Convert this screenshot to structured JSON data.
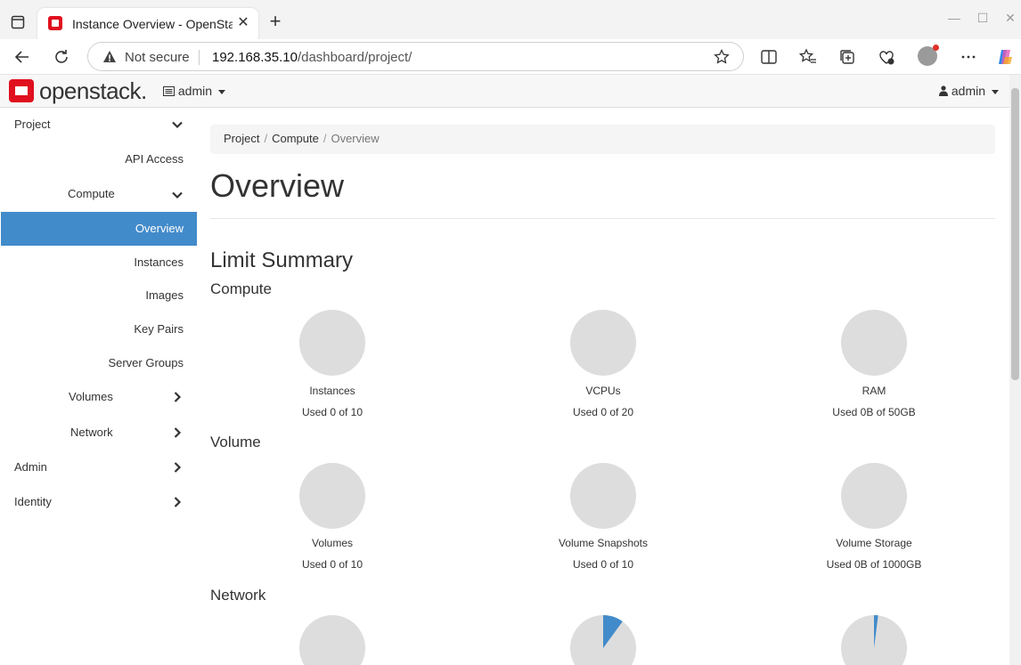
{
  "browser": {
    "tab_title": "Instance Overview - OpenStack",
    "tab_close": "✕",
    "new_tab": "+",
    "security": "Not secure",
    "url_host": "192.168.35.10",
    "url_path": "/dashboard/project/"
  },
  "header": {
    "brand": "openstack.",
    "project": "admin",
    "user": "admin"
  },
  "sidebar": {
    "items": [
      {
        "label": "Project",
        "expanded": true
      },
      {
        "label": "API Access"
      },
      {
        "label": "Compute",
        "expanded": true
      },
      {
        "label": "Overview",
        "active": true
      },
      {
        "label": "Instances"
      },
      {
        "label": "Images"
      },
      {
        "label": "Key Pairs"
      },
      {
        "label": "Server Groups"
      },
      {
        "label": "Volumes",
        "expanded": false
      },
      {
        "label": "Network",
        "expanded": false
      },
      {
        "label": "Admin",
        "expanded": false
      },
      {
        "label": "Identity",
        "expanded": false
      }
    ]
  },
  "breadcrumb": {
    "items": [
      "Project",
      "Compute",
      "Overview"
    ],
    "separator": "/"
  },
  "main": {
    "title": "Overview",
    "limit_summary": "Limit Summary",
    "sections": [
      {
        "title": "Compute",
        "pies": [
          {
            "label": "Instances",
            "used": "Used 0 of 10",
            "fraction": 0
          },
          {
            "label": "VCPUs",
            "used": "Used 0 of 20",
            "fraction": 0
          },
          {
            "label": "RAM",
            "used": "Used 0B of 50GB",
            "fraction": 0
          }
        ]
      },
      {
        "title": "Volume",
        "pies": [
          {
            "label": "Volumes",
            "used": "Used 0 of 10",
            "fraction": 0
          },
          {
            "label": "Volume Snapshots",
            "used": "Used 0 of 10",
            "fraction": 0
          },
          {
            "label": "Volume Storage",
            "used": "Used 0B of 1000GB",
            "fraction": 0
          }
        ]
      },
      {
        "title": "Network",
        "pies": [
          {
            "fraction": 0
          },
          {
            "fraction": 0.1
          },
          {
            "fraction": 0.02
          }
        ]
      }
    ]
  },
  "colors": {
    "pie_empty": "#dddddd",
    "pie_used": "#428bca",
    "active_nav": "#428bca",
    "brand_red": "#e0101f"
  }
}
